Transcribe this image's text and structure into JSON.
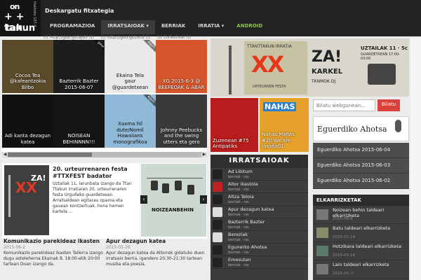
{
  "header": {
    "logo": {
      "line1": "on",
      "line2": "+ + tan",
      "line3": "takun",
      "side": "ttaktoko 107.4"
    },
    "download": "Deskargatu fitxategia",
    "menu": [
      {
        "label": "PROGRAMAZIOA",
        "active": false
      },
      {
        "label": "IRRATSAIOAK ▾",
        "active": true
      },
      {
        "label": "BERRIAK",
        "active": false
      },
      {
        "label": "IRRATIA ▾",
        "active": false
      },
      {
        "label": "ANDROID",
        "active": false
      }
    ],
    "crumbs": [
      "((( http://goo.gl/faJd3 )))",
      "((( http://goo.gl/zxcd )))",
      "((( ttxfestival )))"
    ]
  },
  "slider": {
    "tiles": [
      {
        "line1": "Cocoa Tea",
        "line2": "@kafeantzokia Bilbo",
        "bg": "#5b4a2a",
        "ribbon": ""
      },
      {
        "line1": "Bazterrik Bazter",
        "line2": "2015-06-07",
        "bg": "#1d1d1d",
        "ribbon": "gaur"
      },
      {
        "line1": "Ekaina Tela",
        "line2": "gaur @guardetxean",
        "bg": "#e9e9e9",
        "ribbon": "egun"
      },
      {
        "line1": "XG 2015-6-3 @",
        "line2": "BEEFEOAK & ABAR",
        "bg": "#d7552b",
        "ribbon": ""
      },
      {
        "line1": "Adi kanta dezagun",
        "line2": "katea",
        "bg": "#111111",
        "ribbon": ""
      },
      {
        "line1": "NOISEAN",
        "line2": "BEHINNNN!!!",
        "bg": "#151515",
        "ribbon": ""
      },
      {
        "line1": "Xaxma hil dute/Nomil",
        "line2": "Hawaiians monografikoa",
        "bg": "#8fb9d6",
        "ribbon": "egun"
      },
      {
        "line1": "Johnny Peebucks",
        "line2": "and the swing utters eta gero",
        "bg": "#3a3a3a",
        "ribbon": ""
      }
    ]
  },
  "articles": {
    "main": {
      "title": "20. urteurrenaren festa #TTXFEST badator",
      "body": "Uztailak 11, larunbata izango da Ttan Ttakun irratiaren 20. urteurrenaren festa Urgulleko guardetxean. Arratsaldean egitarau oparoa eta gauean kontzertuak, hona hemen kartela ...",
      "img_xx": "XX",
      "img_za": "ZA!"
    },
    "side": {
      "img_label": "NOIZEANBEHIN"
    },
    "cards": [
      {
        "title": "Komunikazio parekideaz ikasten",
        "date": "2015-06-2",
        "body": "Komunikazio parekideaz ikasten Tallerra izango dugu asteleherna Ekainak 8, 18:00-etik 20:00 tartean Doan izango da."
      },
      {
        "title": "Apur dezagun katea",
        "date": "2015-05-26",
        "body": "Apur dezagun katea da Altorrek gidatuko duen irratsaio berria, igandero 20:30-21:30 tartean musika eta poesia."
      }
    ]
  },
  "banner": {
    "top": "TTANTTAKUN IRRATIA",
    "xx": "XX",
    "sub": "URTEURREN FESTA",
    "za": "ZA!",
    "karkel": "KARKEL",
    "tknmok": "TKNMOK DJ",
    "date": "UZTAILAK 11 · 5c",
    "place": "GUARDETXEAN 17:00-03:00"
  },
  "promos": [
    {
      "big": "",
      "line1": "Zuzenean #75",
      "line2": "Antipatiks"
    },
    {
      "big": "NAHAS",
      "line1": "Nahas Mahas",
      "line2": "#20 We are lasaña01"
    }
  ],
  "radio": {
    "title": "IRRATSAIOAK",
    "stations": [
      {
        "name": "Ad Libitum",
        "sub": "berriak · rss"
      },
      {
        "name": "Altor ikastola",
        "sub": "berriak · rss"
      },
      {
        "name": "Altza Teloia",
        "sub": "berriak · rss"
      },
      {
        "name": "Apur dezagun katea",
        "sub": "berriak · rss"
      },
      {
        "name": "Bazterrik Bazter",
        "sub": "berriak · rss"
      },
      {
        "name": "Bereziak",
        "sub": "berriak · rss"
      },
      {
        "name": "Egunerko Ahotsa",
        "sub": "berriak · rss"
      },
      {
        "name": "Emesutan",
        "sub": "berriak · rss"
      }
    ]
  },
  "search": {
    "placeholder": "Bilatu webgunean...",
    "button": "Bilatu"
  },
  "egunerko": {
    "title": "Eguerdiko Ahotsa",
    "items": [
      "Eguerdiko Ahotsa 2015-06-04",
      "Eguerdiko Ahotsa 2015-06-03",
      "Eguerdiko Ahotsa 2015-06-02"
    ]
  },
  "elkarrizketak": {
    "title": "ELKARRIZKETAK",
    "items": [
      {
        "name": "Noizean behin taldeari elkarrizketa",
        "date": "2015-06-4"
      },
      {
        "name": "Batu taldeari elkarrizketa",
        "date": "2015-05-14"
      },
      {
        "name": "Hotzikara taldeari elkarrizketa",
        "date": "2015-05-14"
      },
      {
        "name": "Lain taldeari elkarrizketa",
        "date": "2015-05-??"
      }
    ]
  },
  "colors": {
    "accent": "#8cc63f",
    "search_btn": "#d9413c",
    "header_bg": "#232323"
  }
}
